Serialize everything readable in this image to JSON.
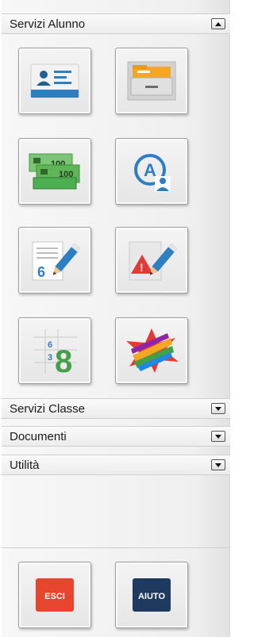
{
  "sections": {
    "servizi_alunno": "Servizi Alunno",
    "servizi_classe": "Servizi Classe",
    "documenti": "Documenti",
    "utilita": "Utilità"
  },
  "tiles": [
    {
      "name": "anagrafica",
      "icon": "id-card-icon"
    },
    {
      "name": "archivio",
      "icon": "file-drawer-icon"
    },
    {
      "name": "tasse",
      "icon": "banknotes-icon",
      "text": [
        "100",
        "100"
      ]
    },
    {
      "name": "assenze",
      "icon": "circled-a-user-icon",
      "text": [
        "A"
      ]
    },
    {
      "name": "voti",
      "icon": "grade-pencil-icon",
      "text": [
        "6"
      ]
    },
    {
      "name": "note-disciplinari",
      "icon": "warning-pencil-icon",
      "text": [
        "!"
      ]
    },
    {
      "name": "pagella",
      "icon": "grade-grid-icon",
      "text": [
        "6",
        "3",
        "8"
      ]
    },
    {
      "name": "bacheca",
      "icon": "colorful-star-icon"
    }
  ],
  "buttons": {
    "esci": "ESCI",
    "aiuto": "AIUTO"
  },
  "colors": {
    "accent_blue": "#2d7fc1",
    "green_money": "#4caf50",
    "red_warning": "#e53935",
    "esci_red": "#e8452f",
    "aiuto_navy": "#1e3a5f"
  }
}
